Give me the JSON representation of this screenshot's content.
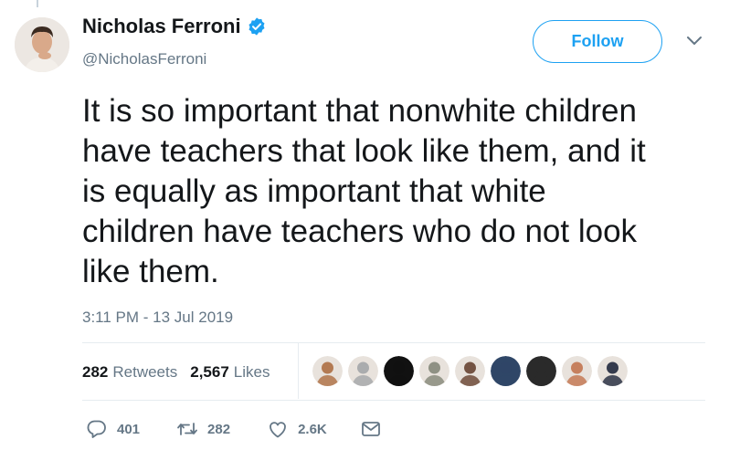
{
  "user": {
    "display_name": "Nicholas Ferroni",
    "handle": "@NicholasFerroni",
    "verified": true
  },
  "follow_label": "Follow",
  "tweet": {
    "lines": [
      "It is so important that nonwhite children",
      "have teachers that look like them, and it",
      "is equally as important that white",
      "children have teachers who do not look",
      "like them."
    ],
    "timestamp": "3:11 PM - 13 Jul 2019"
  },
  "stats": {
    "retweets_count": "282",
    "retweets_label": "Retweets",
    "likes_count": "2,567",
    "likes_label": "Likes"
  },
  "liker_avatars": [
    {
      "color": "#b0744a"
    },
    {
      "color": "#a7a9ab"
    },
    {
      "color": "#111111"
    },
    {
      "color": "#8a8c7e"
    },
    {
      "color": "#6e4b3a"
    },
    {
      "color": "#2f4667"
    },
    {
      "color": "#2a2a2a"
    },
    {
      "color": "#c47a56"
    },
    {
      "color": "#2b3245"
    }
  ],
  "actions": {
    "reply_count": "401",
    "retweet_count": "282",
    "like_count": "2.6K"
  },
  "colors": {
    "accent": "#1da1f2",
    "secondary_text": "#657786",
    "divider": "#e6ecf0"
  },
  "icons": [
    "verified-badge-icon",
    "chevron-down-icon",
    "reply-icon",
    "retweet-icon",
    "like-icon",
    "direct-message-icon"
  ]
}
